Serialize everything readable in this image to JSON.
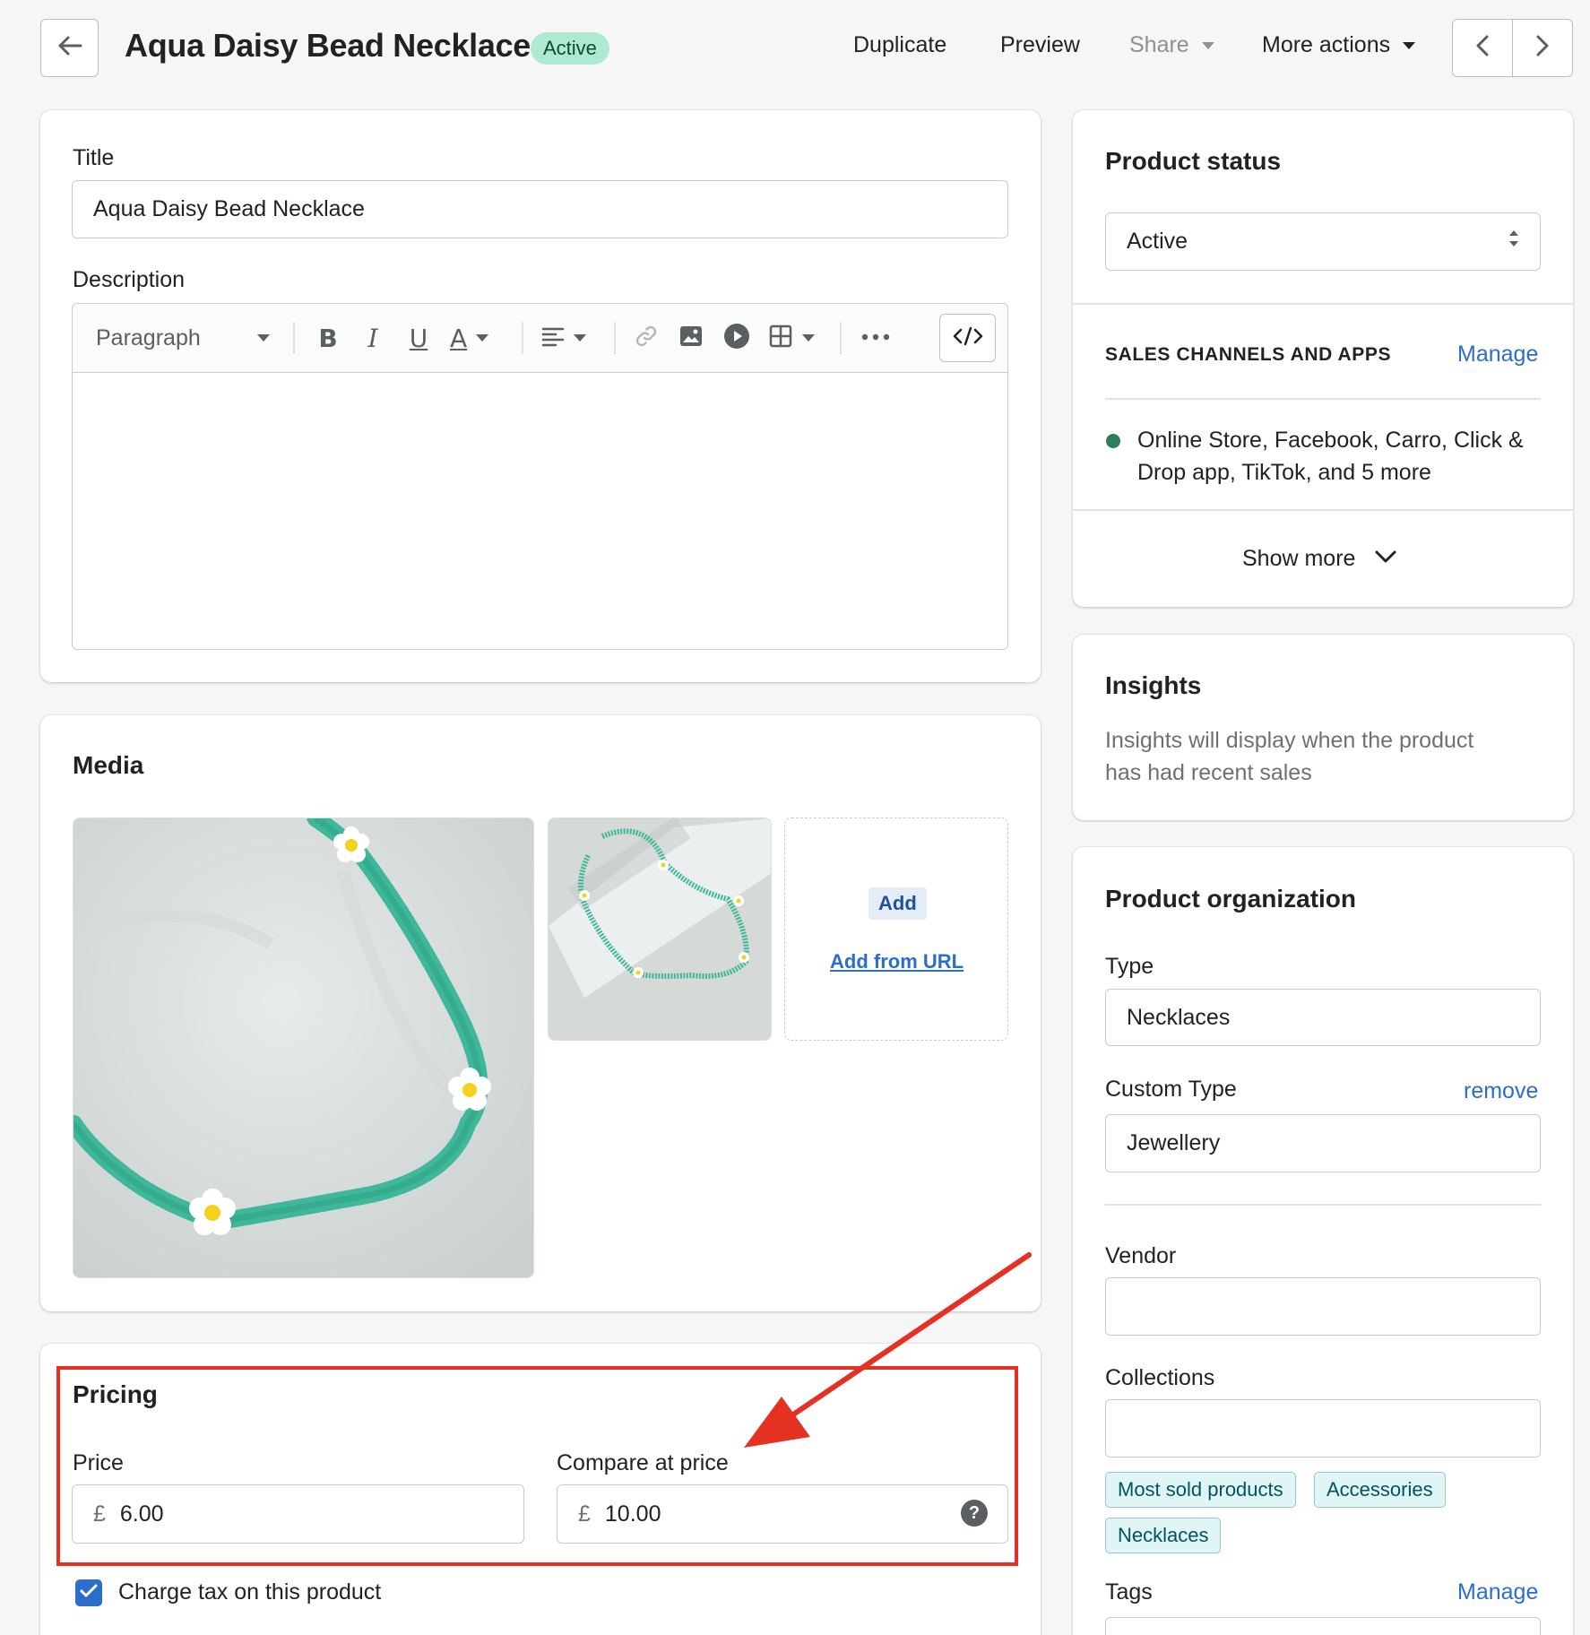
{
  "header": {
    "title": "Aqua Daisy Bead Necklace",
    "status_badge": "Active",
    "actions": {
      "duplicate": "Duplicate",
      "preview": "Preview",
      "share": "Share",
      "more_actions": "More actions"
    }
  },
  "main": {
    "title_label": "Title",
    "title_value": "Aqua Daisy Bead Necklace",
    "description_label": "Description",
    "editor": {
      "paragraph_select": "Paragraph",
      "bold": "B",
      "italic": "I",
      "underline": "U",
      "text_color": "A"
    },
    "media": {
      "title": "Media",
      "add_button": "Add",
      "add_from_url": "Add from URL"
    },
    "pricing": {
      "title": "Pricing",
      "price_label": "Price",
      "price_currency": "£",
      "price_value": "6.00",
      "compare_label": "Compare at price",
      "compare_currency": "£",
      "compare_value": "10.00",
      "help_glyph": "?",
      "charge_tax_label": "Charge tax on this product",
      "charge_tax_checked": true
    }
  },
  "sidebar": {
    "status": {
      "title": "Product status",
      "value": "Active",
      "channels_heading": "SALES CHANNELS AND APPS",
      "manage_link": "Manage",
      "channels_line1": "Online Store, Facebook, Carro, Click &",
      "channels_line2": "Drop app, TikTok, and 5 more",
      "show_more": "Show more"
    },
    "insights": {
      "title": "Insights",
      "text_line1": "Insights will display when the product",
      "text_line2": "has had recent sales"
    },
    "organization": {
      "title": "Product organization",
      "type_label": "Type",
      "type_value": "Necklaces",
      "custom_type_label": "Custom Type",
      "remove_link": "remove",
      "custom_type_value": "Jewellery",
      "vendor_label": "Vendor",
      "vendor_value": "",
      "collections_label": "Collections",
      "collections_value": "",
      "collections": [
        "Most sold products",
        "Accessories",
        "Necklaces"
      ],
      "tags_label": "Tags",
      "tags_manage": "Manage"
    }
  },
  "colors": {
    "accent": "#2c6ecb",
    "active_badge_bg": "#aee9d1",
    "annotation_red": "#e53122",
    "channel_dot": "#2e7d5b"
  },
  "icons": [
    "arrow-left-icon",
    "chevron-left-icon",
    "chevron-right-icon",
    "caret-down-icon",
    "link-icon",
    "image-icon",
    "video-icon",
    "table-icon",
    "more-horizontal-icon",
    "code-icon",
    "align-left-icon",
    "select-arrows-icon",
    "chevron-down-icon",
    "help-icon",
    "checkmark-icon"
  ]
}
